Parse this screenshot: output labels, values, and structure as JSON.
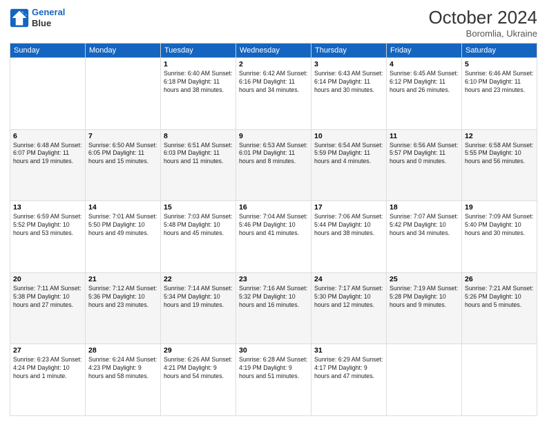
{
  "logo": {
    "line1": "General",
    "line2": "Blue"
  },
  "title": "October 2024",
  "subtitle": "Boromlia, Ukraine",
  "days_of_week": [
    "Sunday",
    "Monday",
    "Tuesday",
    "Wednesday",
    "Thursday",
    "Friday",
    "Saturday"
  ],
  "weeks": [
    [
      {
        "day": "",
        "info": ""
      },
      {
        "day": "",
        "info": ""
      },
      {
        "day": "1",
        "info": "Sunrise: 6:40 AM\nSunset: 6:18 PM\nDaylight: 11 hours and 38 minutes."
      },
      {
        "day": "2",
        "info": "Sunrise: 6:42 AM\nSunset: 6:16 PM\nDaylight: 11 hours and 34 minutes."
      },
      {
        "day": "3",
        "info": "Sunrise: 6:43 AM\nSunset: 6:14 PM\nDaylight: 11 hours and 30 minutes."
      },
      {
        "day": "4",
        "info": "Sunrise: 6:45 AM\nSunset: 6:12 PM\nDaylight: 11 hours and 26 minutes."
      },
      {
        "day": "5",
        "info": "Sunrise: 6:46 AM\nSunset: 6:10 PM\nDaylight: 11 hours and 23 minutes."
      }
    ],
    [
      {
        "day": "6",
        "info": "Sunrise: 6:48 AM\nSunset: 6:07 PM\nDaylight: 11 hours and 19 minutes."
      },
      {
        "day": "7",
        "info": "Sunrise: 6:50 AM\nSunset: 6:05 PM\nDaylight: 11 hours and 15 minutes."
      },
      {
        "day": "8",
        "info": "Sunrise: 6:51 AM\nSunset: 6:03 PM\nDaylight: 11 hours and 11 minutes."
      },
      {
        "day": "9",
        "info": "Sunrise: 6:53 AM\nSunset: 6:01 PM\nDaylight: 11 hours and 8 minutes."
      },
      {
        "day": "10",
        "info": "Sunrise: 6:54 AM\nSunset: 5:59 PM\nDaylight: 11 hours and 4 minutes."
      },
      {
        "day": "11",
        "info": "Sunrise: 6:56 AM\nSunset: 5:57 PM\nDaylight: 11 hours and 0 minutes."
      },
      {
        "day": "12",
        "info": "Sunrise: 6:58 AM\nSunset: 5:55 PM\nDaylight: 10 hours and 56 minutes."
      }
    ],
    [
      {
        "day": "13",
        "info": "Sunrise: 6:59 AM\nSunset: 5:52 PM\nDaylight: 10 hours and 53 minutes."
      },
      {
        "day": "14",
        "info": "Sunrise: 7:01 AM\nSunset: 5:50 PM\nDaylight: 10 hours and 49 minutes."
      },
      {
        "day": "15",
        "info": "Sunrise: 7:03 AM\nSunset: 5:48 PM\nDaylight: 10 hours and 45 minutes."
      },
      {
        "day": "16",
        "info": "Sunrise: 7:04 AM\nSunset: 5:46 PM\nDaylight: 10 hours and 41 minutes."
      },
      {
        "day": "17",
        "info": "Sunrise: 7:06 AM\nSunset: 5:44 PM\nDaylight: 10 hours and 38 minutes."
      },
      {
        "day": "18",
        "info": "Sunrise: 7:07 AM\nSunset: 5:42 PM\nDaylight: 10 hours and 34 minutes."
      },
      {
        "day": "19",
        "info": "Sunrise: 7:09 AM\nSunset: 5:40 PM\nDaylight: 10 hours and 30 minutes."
      }
    ],
    [
      {
        "day": "20",
        "info": "Sunrise: 7:11 AM\nSunset: 5:38 PM\nDaylight: 10 hours and 27 minutes."
      },
      {
        "day": "21",
        "info": "Sunrise: 7:12 AM\nSunset: 5:36 PM\nDaylight: 10 hours and 23 minutes."
      },
      {
        "day": "22",
        "info": "Sunrise: 7:14 AM\nSunset: 5:34 PM\nDaylight: 10 hours and 19 minutes."
      },
      {
        "day": "23",
        "info": "Sunrise: 7:16 AM\nSunset: 5:32 PM\nDaylight: 10 hours and 16 minutes."
      },
      {
        "day": "24",
        "info": "Sunrise: 7:17 AM\nSunset: 5:30 PM\nDaylight: 10 hours and 12 minutes."
      },
      {
        "day": "25",
        "info": "Sunrise: 7:19 AM\nSunset: 5:28 PM\nDaylight: 10 hours and 9 minutes."
      },
      {
        "day": "26",
        "info": "Sunrise: 7:21 AM\nSunset: 5:26 PM\nDaylight: 10 hours and 5 minutes."
      }
    ],
    [
      {
        "day": "27",
        "info": "Sunrise: 6:23 AM\nSunset: 4:24 PM\nDaylight: 10 hours and 1 minute."
      },
      {
        "day": "28",
        "info": "Sunrise: 6:24 AM\nSunset: 4:23 PM\nDaylight: 9 hours and 58 minutes."
      },
      {
        "day": "29",
        "info": "Sunrise: 6:26 AM\nSunset: 4:21 PM\nDaylight: 9 hours and 54 minutes."
      },
      {
        "day": "30",
        "info": "Sunrise: 6:28 AM\nSunset: 4:19 PM\nDaylight: 9 hours and 51 minutes."
      },
      {
        "day": "31",
        "info": "Sunrise: 6:29 AM\nSunset: 4:17 PM\nDaylight: 9 hours and 47 minutes."
      },
      {
        "day": "",
        "info": ""
      },
      {
        "day": "",
        "info": ""
      }
    ]
  ]
}
